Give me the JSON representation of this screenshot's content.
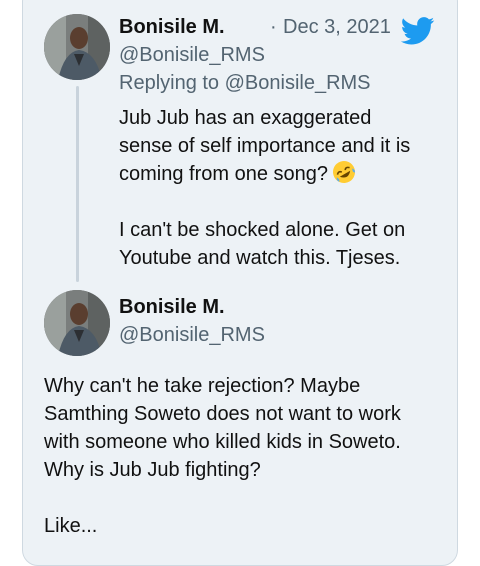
{
  "tweet1": {
    "display_name": "Bonisile M.",
    "handle": "@Bonisile_RMS",
    "separator": "·",
    "date": "Dec 3, 2021",
    "replying_to": "Replying to @Bonisile_RMS",
    "line1": "Jub Jub has an exaggerated",
    "line2": "sense of self importance and it is",
    "line3": "coming from one song?",
    "emoji_icon": "rolling-on-floor-laughing-icon",
    "line4": "I can't be shocked alone. Get on",
    "line5": "Youtube and watch this. Tjeses."
  },
  "tweet2": {
    "display_name": "Bonisile M.",
    "handle": "@Bonisile_RMS",
    "line1": "Why can't he take rejection? Maybe",
    "line2": "Samthing Soweto does not want to work",
    "line3": "with someone who killed kids in Soweto.",
    "line4": "Why is Jub Jub fighting?",
    "line5": "Like..."
  },
  "colors": {
    "twitter_blue": "#1d9bf0",
    "card_bg": "#edf2f6",
    "secondary_text": "#536471"
  }
}
